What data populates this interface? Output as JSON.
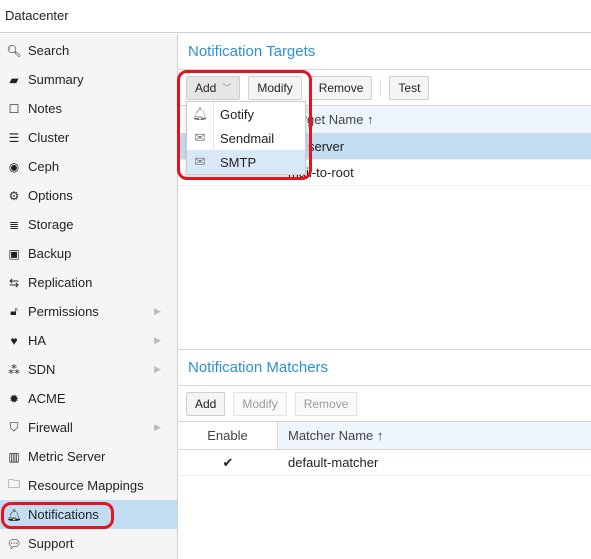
{
  "header": {
    "title": "Datacenter"
  },
  "sidebar": {
    "items": [
      {
        "label": "Search",
        "icon": "search-icon",
        "glyph": "🔍︎"
      },
      {
        "label": "Summary",
        "icon": "book-icon",
        "glyph": "▰"
      },
      {
        "label": "Notes",
        "icon": "note-icon",
        "glyph": "☐"
      },
      {
        "label": "Cluster",
        "icon": "server-icon",
        "glyph": "☰"
      },
      {
        "label": "Ceph",
        "icon": "ceph-icon",
        "glyph": "◉"
      },
      {
        "label": "Options",
        "icon": "gear-icon",
        "glyph": "⚙"
      },
      {
        "label": "Storage",
        "icon": "database-icon",
        "glyph": "≣"
      },
      {
        "label": "Backup",
        "icon": "floppy-icon",
        "glyph": "▣"
      },
      {
        "label": "Replication",
        "icon": "retweet-icon",
        "glyph": "⇆"
      },
      {
        "label": "Permissions",
        "icon": "unlock-icon",
        "glyph": "🔓︎",
        "sub": true
      },
      {
        "label": "HA",
        "icon": "heartbeat-icon",
        "glyph": "♥",
        "sub": true
      },
      {
        "label": "SDN",
        "icon": "sdn-icon",
        "glyph": "⁂",
        "sub": true
      },
      {
        "label": "ACME",
        "icon": "certificate-icon",
        "glyph": "✹"
      },
      {
        "label": "Firewall",
        "icon": "shield-icon",
        "glyph": "⛉",
        "sub": true
      },
      {
        "label": "Metric Server",
        "icon": "bar-chart-icon",
        "glyph": "▥"
      },
      {
        "label": "Resource Mappings",
        "icon": "folder-icon",
        "glyph": "🗀"
      },
      {
        "label": "Notifications",
        "icon": "bell-icon",
        "glyph": "🔔︎",
        "selected": true
      },
      {
        "label": "Support",
        "icon": "comments-icon",
        "glyph": "💬︎"
      }
    ]
  },
  "targets": {
    "title": "Notification Targets",
    "toolbar": {
      "add": "Add",
      "modify": "Modify",
      "remove": "Remove",
      "test": "Test"
    },
    "columns": [
      "",
      "Target Name ↑"
    ],
    "rows": [
      {
        "name": "server",
        "selected": true
      },
      {
        "name": "mail-to-root"
      }
    ],
    "add_menu": [
      {
        "label": "Gotify",
        "icon": "bell-icon",
        "glyph": "🔔︎"
      },
      {
        "label": "Sendmail",
        "icon": "envelope-icon",
        "glyph": "✉"
      },
      {
        "label": "SMTP",
        "icon": "envelope-icon",
        "glyph": "✉",
        "hover": true
      }
    ]
  },
  "matchers": {
    "title": "Notification Matchers",
    "toolbar": {
      "add": "Add",
      "modify": "Modify",
      "remove": "Remove"
    },
    "columns": [
      "Enable",
      "Matcher Name ↑"
    ],
    "rows": [
      {
        "enable": "✔",
        "name": "default-matcher"
      }
    ]
  },
  "colors": {
    "accent": "#2c8fd6",
    "selection": "#c2ddf2",
    "highlight": "#e8121f"
  }
}
